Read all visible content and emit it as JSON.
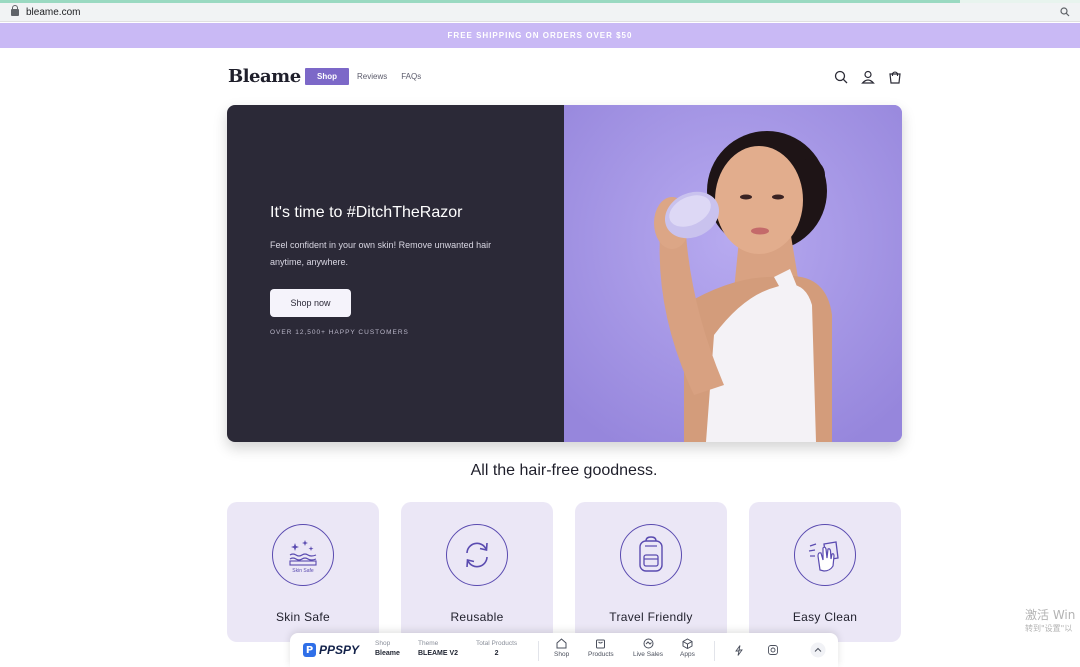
{
  "browser": {
    "url": "bleame.com"
  },
  "announcement": "FREE SHIPPING ON ORDERS OVER $50",
  "header": {
    "logo": "Bleame",
    "nav": [
      "Shop",
      "Reviews",
      "FAQs"
    ],
    "icons": [
      "search-icon",
      "account-icon",
      "cart-icon"
    ]
  },
  "hero": {
    "title": "It's time to #DitchTheRazor",
    "text": "Feel confident in your own skin! Remove unwanted hair anytime, anywhere.",
    "button": "Shop now",
    "customers": "OVER 12,500+ HAPPY CUSTOMERS"
  },
  "features": {
    "title": "All the hair-free goodness.",
    "items": [
      {
        "label": "Skin Safe",
        "icon": "skin-safe-icon",
        "icon_text": "Skin Safe"
      },
      {
        "label": "Reusable",
        "icon": "reusable-icon"
      },
      {
        "label": "Travel Friendly",
        "icon": "backpack-icon"
      },
      {
        "label": "Easy Clean",
        "icon": "easy-clean-icon"
      }
    ]
  },
  "ppspy": {
    "name": "PPSPY",
    "shop_label": "Shop",
    "shop_value": "Bleame",
    "theme_label": "Theme",
    "theme_value": "BLEAME V2",
    "products_label": "Total Products",
    "products_value": "2",
    "buttons": [
      "Shop",
      "Products",
      "Live Sales",
      "Apps"
    ]
  },
  "watermark": {
    "line1": "激活 Win",
    "line2": "转到\"设置\"以"
  },
  "colors": {
    "accent": "#7c68c8",
    "announcement_bg": "#c9b9f5",
    "hero_dark": "#2b2937",
    "card_bg": "#ebe7f6"
  }
}
